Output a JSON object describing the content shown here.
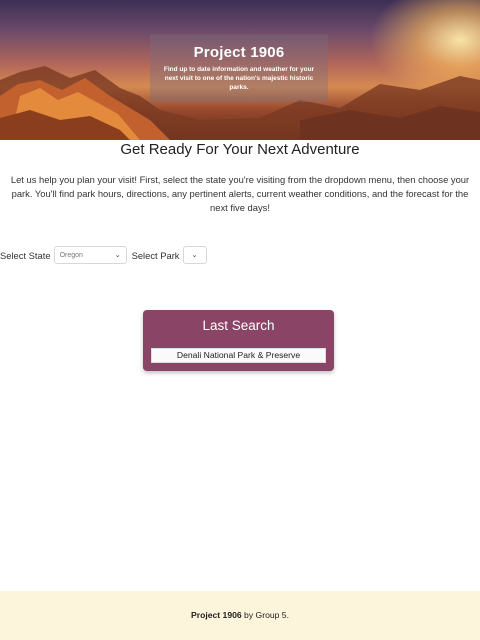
{
  "hero": {
    "title": "Project 1906",
    "subtitle": "Find up to date information and weather for your next visit to one of the nation's majestic historic parks."
  },
  "main": {
    "headline": "Get Ready For Your Next Adventure",
    "intro": "Let us help you plan your visit! First, select the state you're visiting from the dropdown menu, then choose your park. You'll find park hours, directions, any pertinent alerts, current weather conditions, and the forecast for the next five days!"
  },
  "form": {
    "state_label": "Select State",
    "state_value": "Oregon",
    "park_label": "Select Park",
    "park_value": ""
  },
  "last_search": {
    "title": "Last Search",
    "items": [
      "Denali National Park & Preserve"
    ]
  },
  "footer": {
    "brand": "Project 1906",
    "suffix": " by Group 5."
  },
  "colors": {
    "card": "#8a4466",
    "footer_bg": "#fdf4dc"
  },
  "icons": {
    "dropdown": "chevron-down-icon"
  }
}
